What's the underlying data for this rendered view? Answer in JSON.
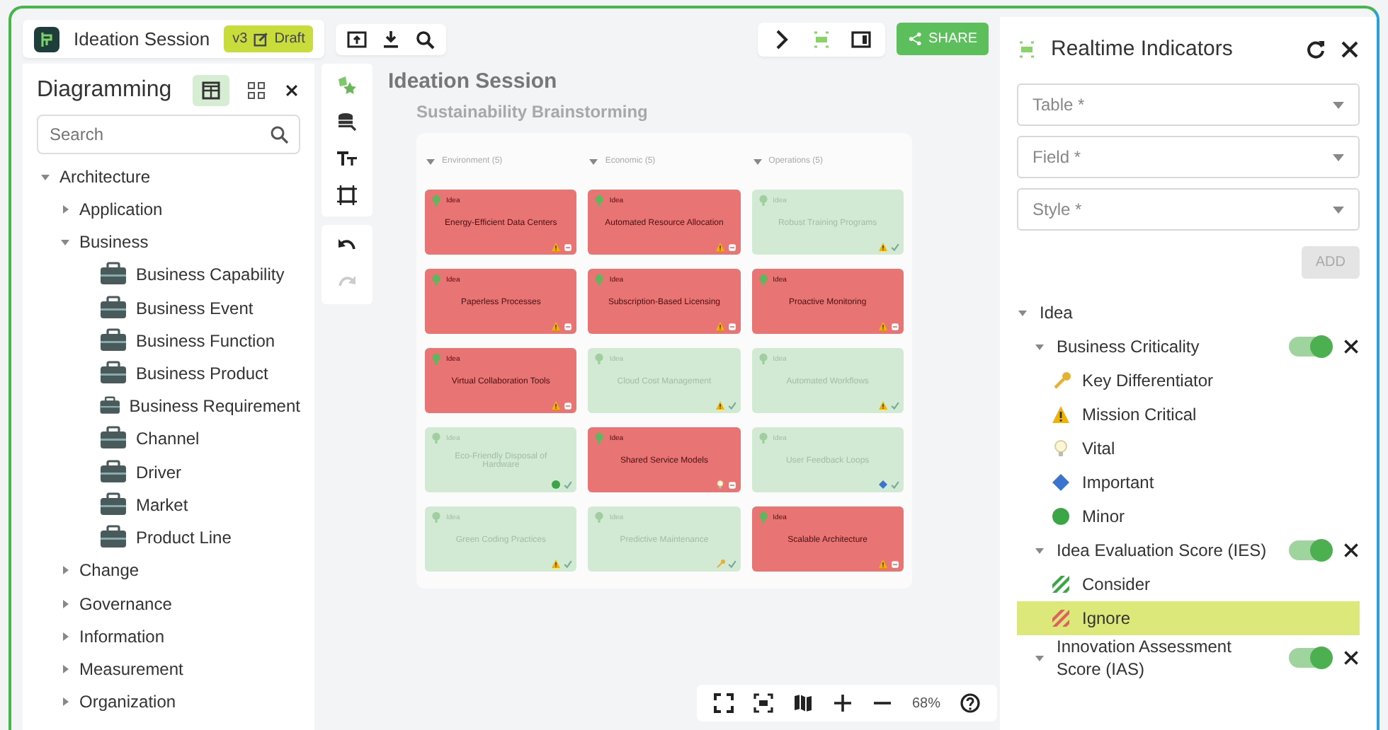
{
  "top_bar": {
    "title": "Ideation Session",
    "version": "v3",
    "status": "Draft"
  },
  "sidebar": {
    "title": "Diagramming",
    "view_modes": [
      {
        "selected": true
      },
      {
        "selected": false
      }
    ],
    "search": {
      "placeholder": "Search"
    },
    "tree": [
      {
        "label": "Architecture",
        "expanded": true,
        "children": [
          {
            "label": "Application",
            "expanded": false
          },
          {
            "label": "Business",
            "expanded": true,
            "children": [
              {
                "label": "Business Capability"
              },
              {
                "label": "Business Event"
              },
              {
                "label": "Business Function"
              },
              {
                "label": "Business Product"
              },
              {
                "label": "Business Requirement"
              },
              {
                "label": "Channel"
              },
              {
                "label": "Driver"
              },
              {
                "label": "Market"
              },
              {
                "label": "Product Line"
              }
            ]
          },
          {
            "label": "Change",
            "expanded": false
          },
          {
            "label": "Governance",
            "expanded": false
          },
          {
            "label": "Information",
            "expanded": false
          },
          {
            "label": "Measurement",
            "expanded": false
          },
          {
            "label": "Organization",
            "expanded": false
          }
        ]
      }
    ]
  },
  "canvas": {
    "title": "Ideation Session",
    "subtitle": "Sustainability Brainstorming",
    "columns": [
      {
        "label": "Environment (5)",
        "expanded": true,
        "cards": [
          {
            "tag": "Idea",
            "title": "Energy-Efficient Data Centers",
            "ignored": true,
            "kind": "warning"
          },
          {
            "tag": "Idea",
            "title": "Paperless Processes",
            "ignored": true,
            "kind": "warning"
          },
          {
            "tag": "Idea",
            "title": "Virtual Collaboration Tools",
            "ignored": true,
            "kind": "warning"
          },
          {
            "tag": "Idea",
            "title": "Eco-Friendly Disposal of Hardware",
            "ignored": false,
            "kind": "dot"
          },
          {
            "tag": "Idea",
            "title": "Green Coding Practices",
            "ignored": false,
            "kind": "warning"
          }
        ]
      },
      {
        "label": "Economic (5)",
        "expanded": true,
        "cards": [
          {
            "tag": "Idea",
            "title": "Automated Resource Allocation",
            "ignored": true,
            "kind": "warning"
          },
          {
            "tag": "Idea",
            "title": "Subscription-Based Licensing",
            "ignored": true,
            "kind": "warning"
          },
          {
            "tag": "Idea",
            "title": "Cloud Cost Management",
            "ignored": false,
            "kind": "warning"
          },
          {
            "tag": "Idea",
            "title": "Shared Service Models",
            "ignored": true,
            "kind": "bulb"
          },
          {
            "tag": "Idea",
            "title": "Predictive Maintenance",
            "ignored": false,
            "kind": "key"
          }
        ]
      },
      {
        "label": "Operations (5)",
        "expanded": true,
        "cards": [
          {
            "tag": "Idea",
            "title": "Robust Training Programs",
            "ignored": false,
            "kind": "warning"
          },
          {
            "tag": "Idea",
            "title": "Proactive Monitoring",
            "ignored": true,
            "kind": "warning"
          },
          {
            "tag": "Idea",
            "title": "Automated Workflows",
            "ignored": false,
            "kind": "warning"
          },
          {
            "tag": "Idea",
            "title": "User Feedback Loops",
            "ignored": false,
            "kind": "diamond"
          },
          {
            "tag": "Idea",
            "title": "Scalable Architecture",
            "ignored": true,
            "kind": "warning"
          }
        ]
      }
    ]
  },
  "zoom": {
    "reading": "68%"
  },
  "share_button": "SHARE",
  "panel": {
    "title": "Realtime Indicators",
    "selects": [
      {
        "placeholder": "Table *"
      },
      {
        "placeholder": "Field *"
      },
      {
        "placeholder": "Style *"
      }
    ],
    "add_button": {
      "label": "ADD",
      "disabled": true
    },
    "tree": {
      "label": "Idea",
      "expanded": true,
      "indicators": [
        {
          "label": "Business Criticality",
          "expanded": true,
          "on": true,
          "legend": [
            {
              "kind": "key",
              "label": "Key Differentiator",
              "selected": false
            },
            {
              "kind": "warning",
              "label": "Mission Critical",
              "selected": false
            },
            {
              "kind": "bulb",
              "label": "Vital",
              "selected": false
            },
            {
              "kind": "diamond",
              "label": "Important",
              "selected": false
            },
            {
              "kind": "dot",
              "label": "Minor",
              "selected": false
            }
          ]
        },
        {
          "label": "Idea Evaluation Score (IES)",
          "expanded": true,
          "on": true,
          "legend": [
            {
              "kind": "consider",
              "label": "Consider",
              "selected": false
            },
            {
              "kind": "ignore",
              "label": "Ignore",
              "selected": true
            }
          ]
        },
        {
          "label": "Innovation Assessment Score (IAS)",
          "expanded": true,
          "on": true
        }
      ]
    }
  }
}
